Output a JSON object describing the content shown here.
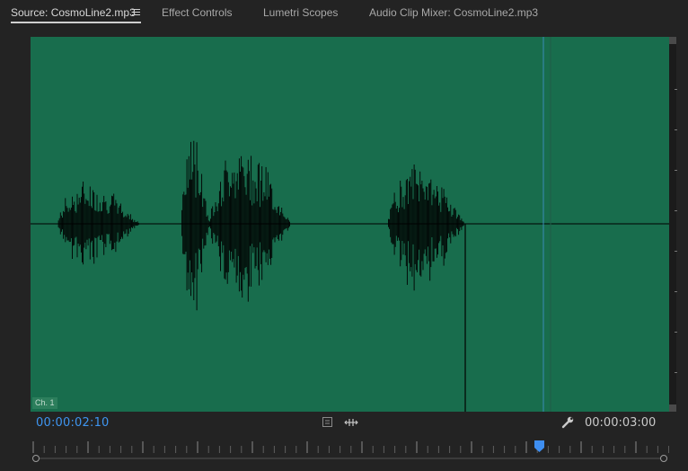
{
  "tabs": [
    {
      "label": "Source: CosmoLine2.mp3",
      "active": true
    },
    {
      "label": "Effect Controls",
      "active": false
    },
    {
      "label": "Lumetri Scopes",
      "active": false
    },
    {
      "label": "Audio Clip Mixer: CosmoLine2.mp3",
      "active": false
    }
  ],
  "panel": {
    "channel_label": "Ch. 1",
    "background_color": "#186d4d",
    "waveform_color": "#000000",
    "playhead_color": "#3a8ab8"
  },
  "footer": {
    "current_time": "00:00:02:10",
    "duration": "00:00:03:00",
    "current_time_color": "#3e95f0"
  },
  "icons": {
    "panel_menu": "hamburger-menu-icon",
    "marker": "marker-icon",
    "insert": "insert-icon",
    "settings": "wrench-icon"
  }
}
